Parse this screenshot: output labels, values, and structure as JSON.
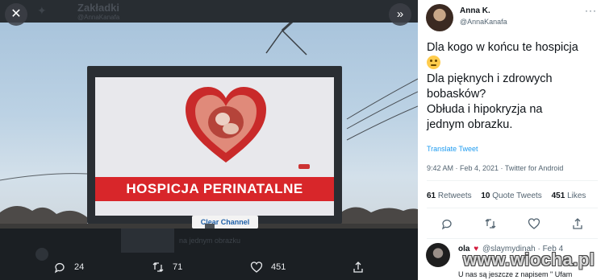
{
  "background_page": {
    "title": "Zakładki",
    "handle": "@AnnaKanafa",
    "below_text": "na jednym obrazku"
  },
  "viewer": {
    "close_icon": "close-icon",
    "expand_icon": "chevron-double-right-icon",
    "billboard": {
      "headline": "HOSPICJA PERINATALNE",
      "sponsor": "Clear Channel",
      "band_color": "#d8262a",
      "heart_color": "#c92a2a"
    },
    "actions": {
      "replies": "24",
      "retweets": "71",
      "likes": "451"
    }
  },
  "tweet": {
    "author_name": "Anna K.",
    "author_handle": "@AnnaKanafa",
    "text_lines": [
      "Dla kogo w końcu te hospicja",
      "",
      "Dla pięknych i zdrowych",
      "bobasków?",
      "Obłuda i hipokryzja na",
      "jednym obrazku."
    ],
    "translate": "Translate Tweet",
    "timestamp": "9:42 AM · Feb 4, 2021 · Twitter for Android",
    "stats": {
      "retweets_count": "61",
      "retweets_label": "Retweets",
      "quotes_count": "10",
      "quotes_label": "Quote Tweets",
      "likes_count": "451",
      "likes_label": "Likes"
    },
    "accent": "#1d9bf0"
  },
  "reply": {
    "name": "ola",
    "handle": "@slaymydinah",
    "date": "· Feb 4",
    "text": "U nas są jeszcze z napisem \" Ufam"
  },
  "watermark": "www.wiocha.pl"
}
